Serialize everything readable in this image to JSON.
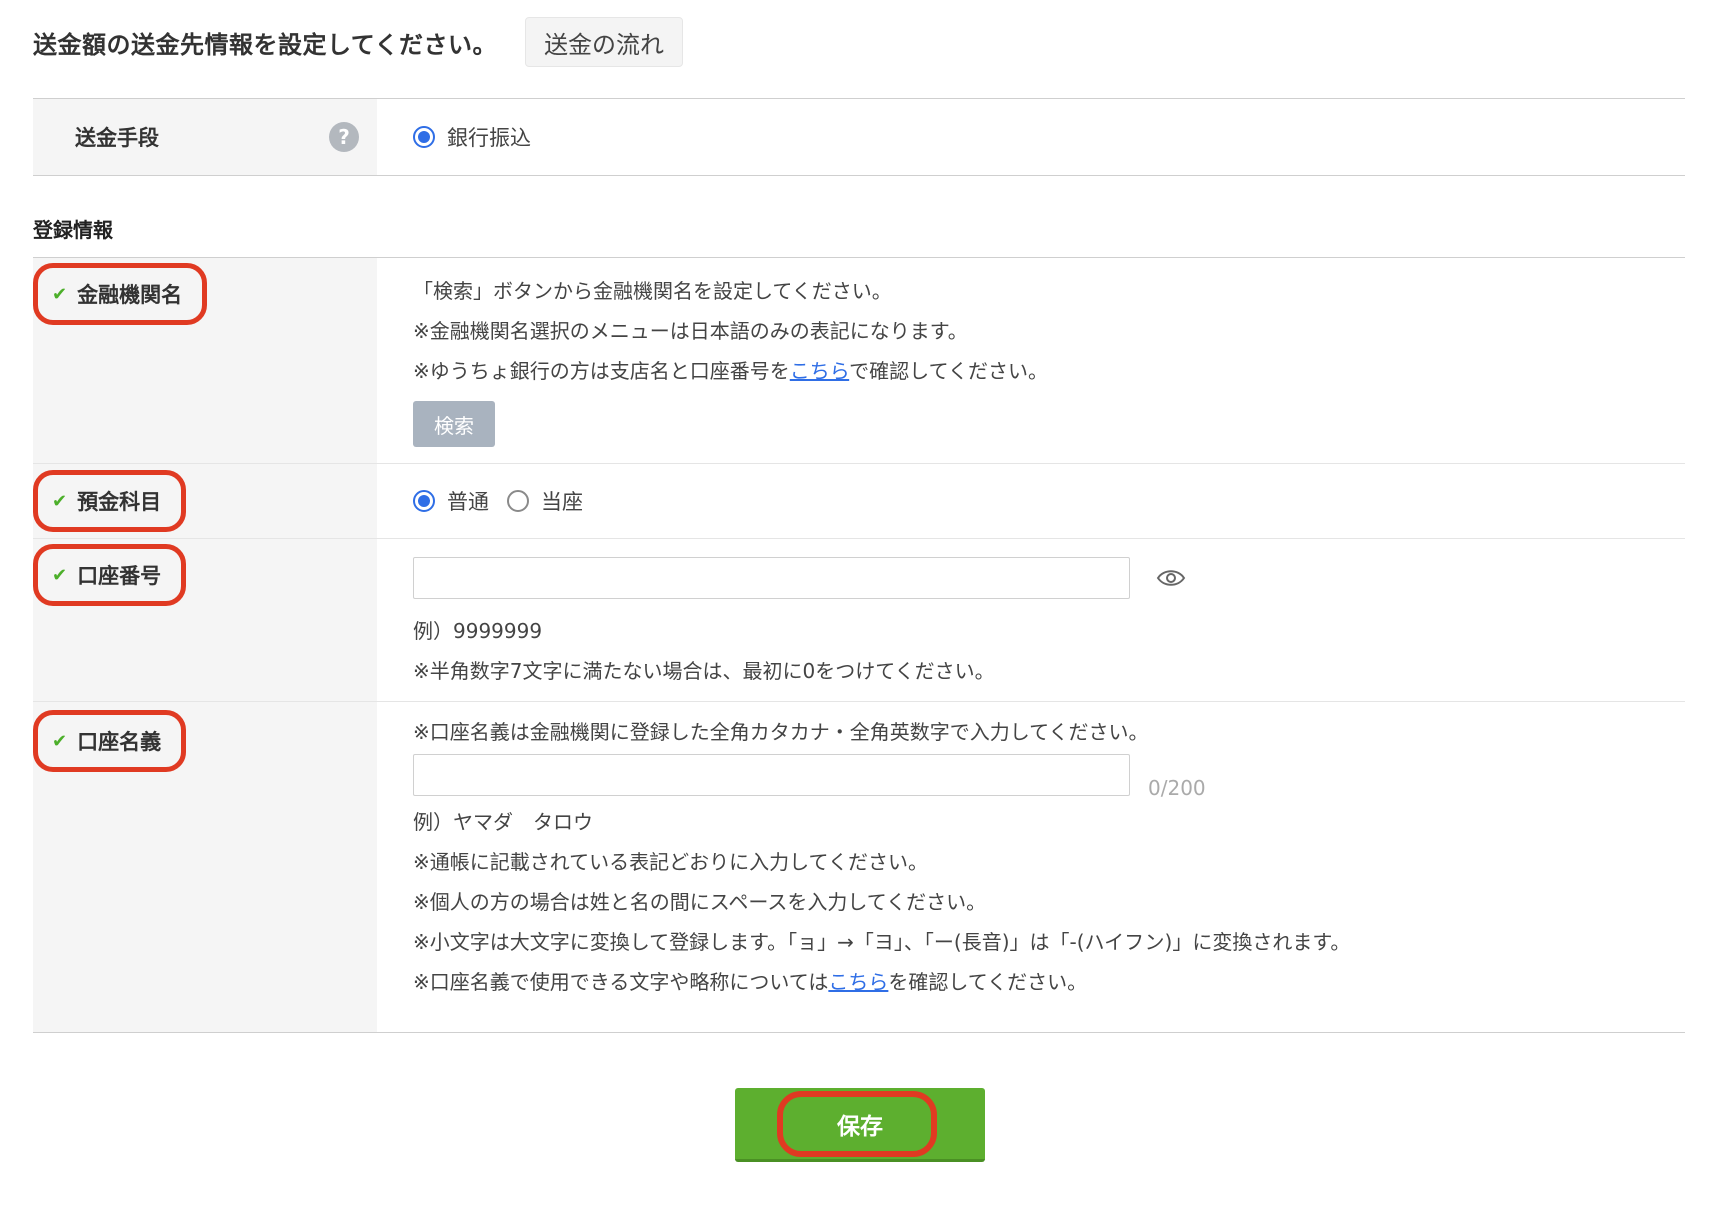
{
  "header": {
    "title": "送金額の送金先情報を設定してください。",
    "flow_button": "送金の流れ"
  },
  "method": {
    "label": "送金手段",
    "help_icon": "?",
    "option": "銀行振込",
    "selected": true
  },
  "registration": {
    "heading": "登録情報",
    "bank": {
      "label": "金融機関名",
      "line1": "「検索」ボタンから金融機関名を設定してください。",
      "line2": "※金融機関名選択のメニューは日本語のみの表記になります。",
      "line3_prefix": "※ゆうちょ銀行の方は支店名と口座番号を",
      "line3_link": "こちら",
      "line3_suffix": "で確認してください。",
      "search_button": "検索"
    },
    "account_type": {
      "label": "預金科目",
      "options": [
        "普通",
        "当座"
      ],
      "selected": "普通"
    },
    "account_number": {
      "label": "口座番号",
      "value": "",
      "example": "例）9999999",
      "note": "※半角数字7文字に満たない場合は、最初に0をつけてください。"
    },
    "account_holder": {
      "label": "口座名義",
      "intro": "※口座名義は金融機関に登録した全角カタカナ・全角英数字で入力してください。",
      "value": "",
      "counter": "0/200",
      "example": "例）ヤマダ　タロウ",
      "note1": "※通帳に記載されている表記どおりに入力してください。",
      "note2": "※個人の方の場合は姓と名の間にスペースを入力してください。",
      "note3": "※小文字は大文字に変換して登録します。「ョ」→「ヨ」、「ー(長音)」は「-(ハイフン)」に変換されます。",
      "note4_prefix": "※口座名義で使用できる文字や略称については",
      "note4_link": "こちら",
      "note4_suffix": "を確認してください。"
    }
  },
  "save_button": "保存",
  "colors": {
    "accent_blue": "#2f6ee6",
    "save_green": "#5daf2f",
    "highlight_red": "#e03a22",
    "check_green": "#4caf2a"
  }
}
